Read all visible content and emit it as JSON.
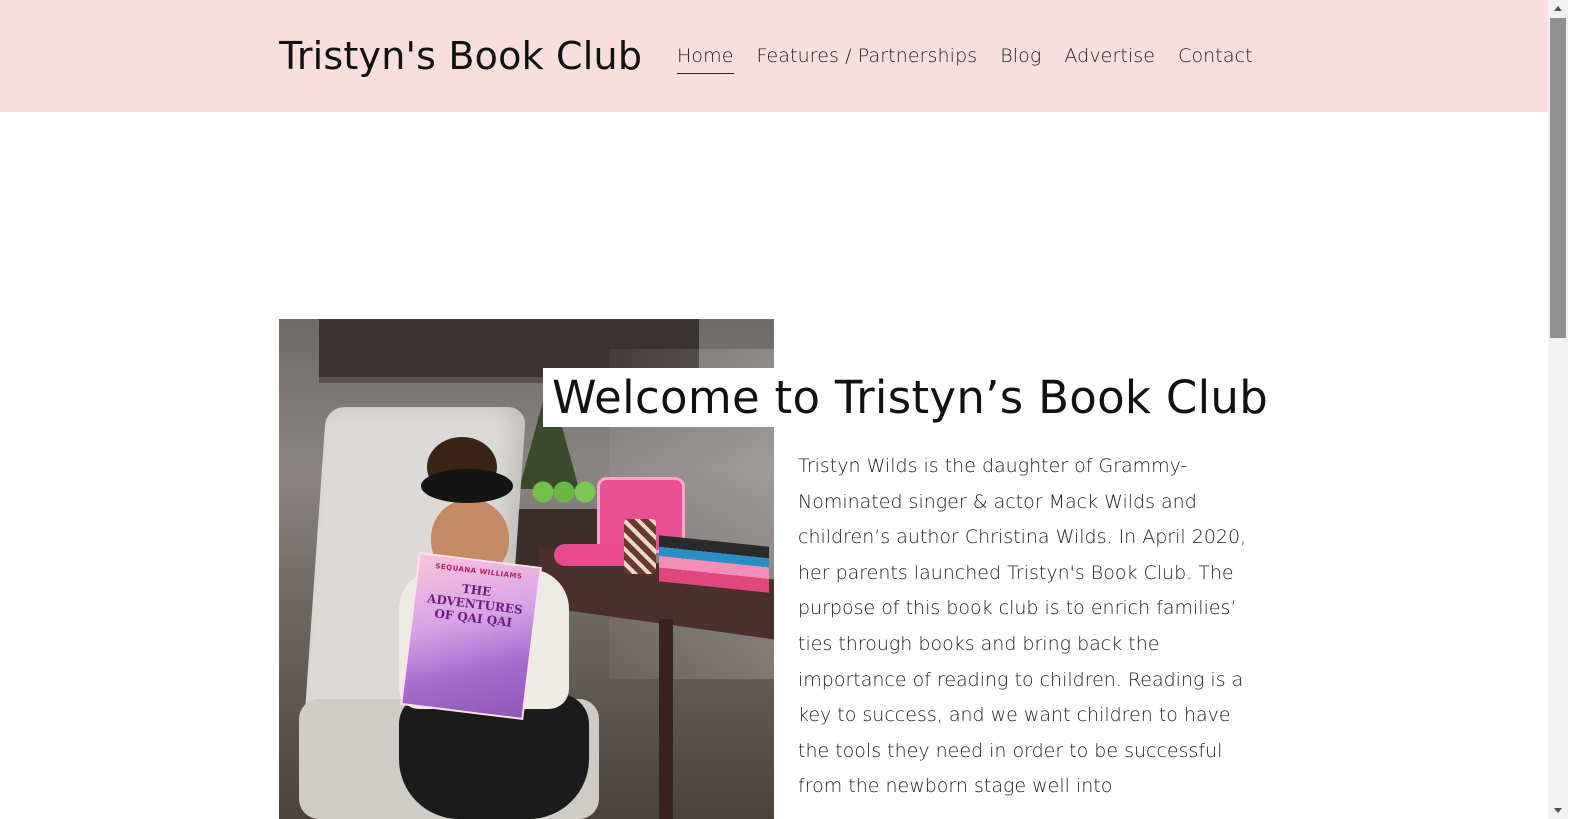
{
  "header": {
    "site_title": "Tristyn's Book Club",
    "nav": [
      {
        "label": "Home",
        "active": true
      },
      {
        "label": "Features / Partnerships",
        "active": false
      },
      {
        "label": "Blog",
        "active": false
      },
      {
        "label": "Advertise",
        "active": false
      },
      {
        "label": "Contact",
        "active": false
      }
    ],
    "background_color": "#f8dedd"
  },
  "main": {
    "welcome_title": "Welcome to Tristyn’s Book Club",
    "intro_text": "Tristyn Wilds is the daughter of Grammy-Nominated singer & actor Mack Wilds and children’s author Christina Wilds. In April 2020, her parents launched Tristyn's Book Club. The purpose of this book club is to enrich families’ ties through books and bring back the importance of reading to children. Reading is a key to success, and we want children to have the tools they need in order to be successful from the newborn stage well into",
    "photo": {
      "book_author": "SEQUANA WILLIAMS",
      "book_title": "THE ADVENTURES OF QAI QAI"
    }
  }
}
